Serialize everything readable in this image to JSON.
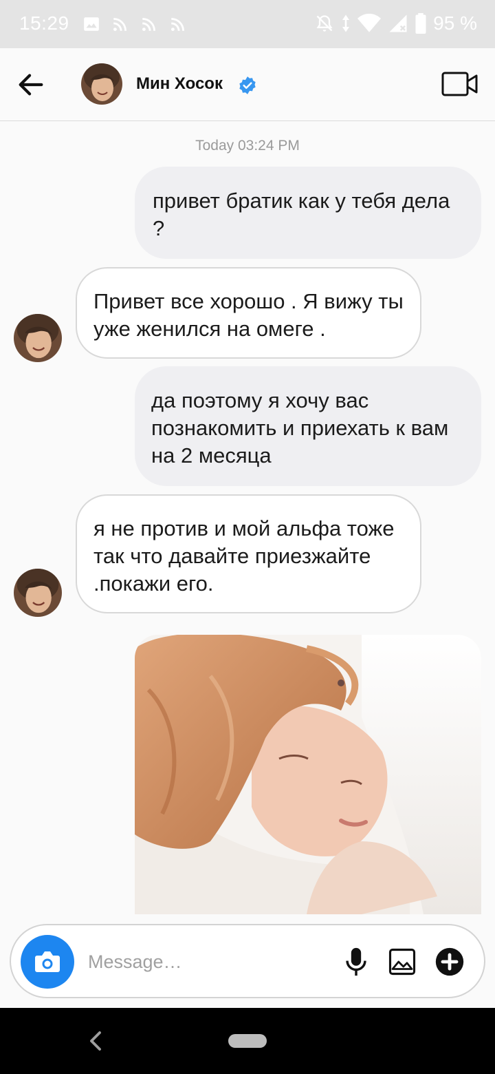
{
  "status_bar": {
    "time": "15:29",
    "battery": "95 %",
    "icons_left": [
      "image-icon",
      "cast-icon",
      "cast-icon",
      "cast-icon"
    ],
    "icons_right": [
      "notifications-off-icon",
      "data-arrows-icon",
      "wifi-icon",
      "signal-icon",
      "battery-icon"
    ]
  },
  "header": {
    "contact_name": "Мин Хосок",
    "verified": true,
    "accent_color": "#3897f0"
  },
  "conversation": {
    "timestamp": "Today 03:24 PM",
    "messages": [
      {
        "direction": "outgoing",
        "text": "привет братик как у тебя дела ?"
      },
      {
        "direction": "incoming",
        "text": "Привет все хорошо . Я вижу ты уже женился на омеге ."
      },
      {
        "direction": "outgoing",
        "text": "да поэтому я хочу вас познакомить и приехать к вам на 2 месяца"
      },
      {
        "direction": "incoming",
        "text": "я не против и мой альфа тоже так что давайте приезжайте .покажи его."
      },
      {
        "direction": "outgoing",
        "type": "photo"
      }
    ]
  },
  "composer": {
    "placeholder": "Message…",
    "value": "",
    "camera_color": "#1d86f0"
  }
}
